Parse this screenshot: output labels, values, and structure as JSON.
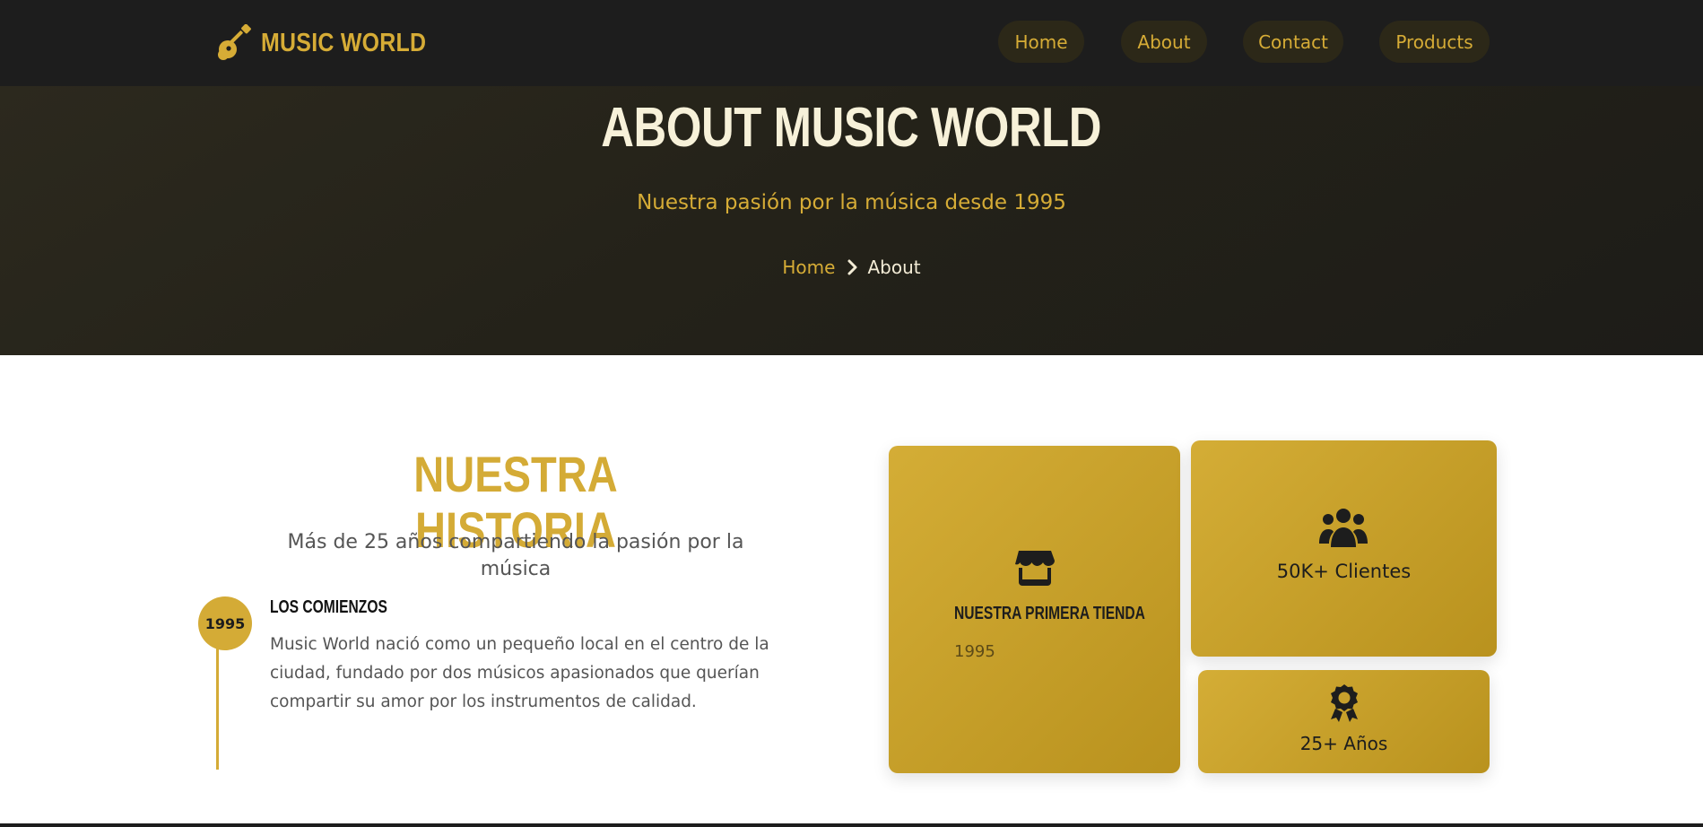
{
  "brand": {
    "name": "MUSIC WORLD",
    "icon": "guitar-icon",
    "color": "#d6ac36"
  },
  "nav": {
    "items": [
      {
        "label": "Home"
      },
      {
        "label": "About"
      },
      {
        "label": "Contact"
      },
      {
        "label": "Products"
      }
    ]
  },
  "hero": {
    "title": "ABOUT MUSIC WORLD",
    "subtitle": "Nuestra pasión por la música desde 1995",
    "breadcrumb": {
      "home": "Home",
      "separator_icon": "chevron-right-icon",
      "current": "About"
    }
  },
  "history": {
    "title": "NUESTRA HISTORIA",
    "subtitle": "Más de 25 años compartiendo la pasión por la música",
    "timeline": [
      {
        "year": "1995",
        "heading": "LOS COMIENZOS",
        "text": "Music World nació como un pequeño local en el centro de la ciudad, fundado por dos músicos apasionados que querían compartir su amor por los instrumentos de calidad."
      }
    ]
  },
  "cards": {
    "store": {
      "icon": "store-icon",
      "title": "NUESTRA PRIMERA TIENDA",
      "year": "1995"
    },
    "clients": {
      "icon": "users-icon",
      "label": "50K+ Clientes"
    },
    "years": {
      "icon": "award-icon",
      "label": "25+ Años"
    }
  },
  "colors": {
    "accent": "#d4ab36",
    "dark": "#1d1d1d",
    "hero_text": "#f7f1d9"
  }
}
